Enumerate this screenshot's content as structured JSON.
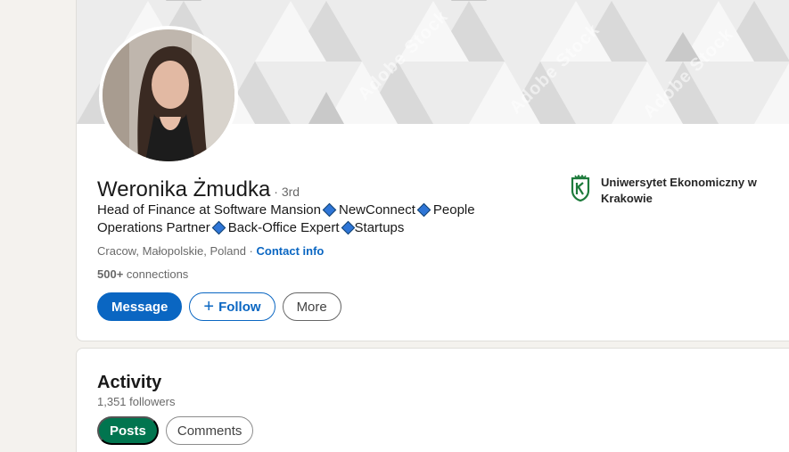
{
  "profile": {
    "name": "Weronika Żmudka",
    "degree": "· 3rd",
    "headline_parts": [
      "Head of Finance at Software Mansion",
      "NewConnect",
      "People Operations Partner",
      "Back-Office Expert",
      "Startups"
    ],
    "location": "Cracow, Małopolskie, Poland",
    "separator": "·",
    "contact_info": "Contact info",
    "connections_count": "500+",
    "connections_label": "connections",
    "buttons": {
      "message": "Message",
      "follow": "Follow",
      "more": "More"
    },
    "education": {
      "name": "Uniwersytet Ekonomiczny w Krakowie",
      "logo_color": "#1e7b3c"
    },
    "banner_watermark": "Adobe Stock"
  },
  "activity": {
    "title": "Activity",
    "followers": "1,351 followers",
    "tabs": [
      "Posts",
      "Comments"
    ]
  },
  "colors": {
    "primary_blue": "#0a66c2",
    "posts_green": "#01754f",
    "diamond_blue": "#2e75d6"
  }
}
